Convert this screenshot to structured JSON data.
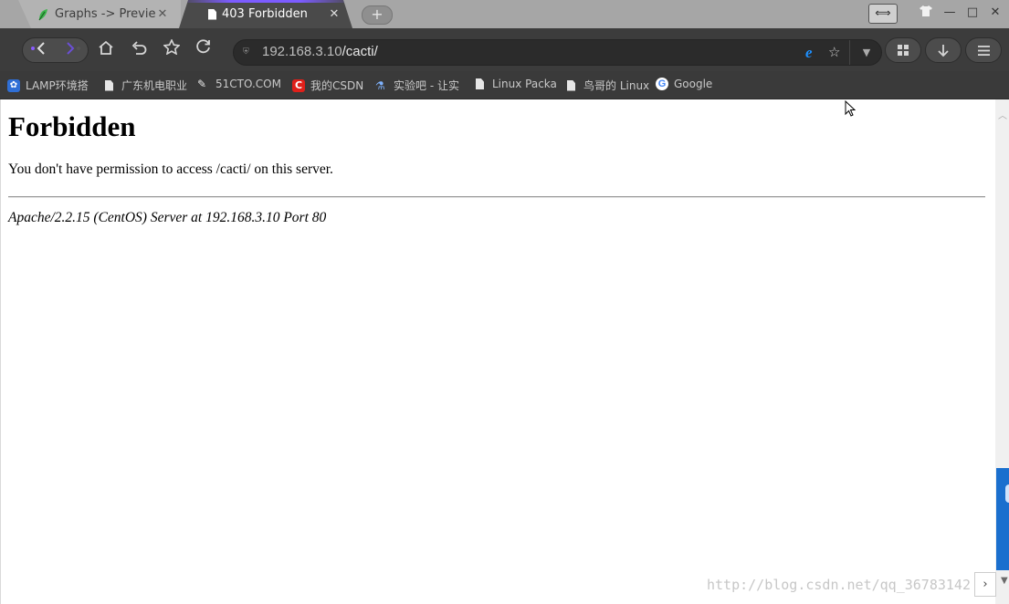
{
  "tabs": [
    {
      "title": "Graphs -> Preview",
      "close_glyph": "✕",
      "favicon": "cacti-leaf-icon",
      "active": false
    },
    {
      "title": "403 Forbidden",
      "close_glyph": "✕",
      "favicon": "page-icon",
      "active": true
    }
  ],
  "window": {
    "new_tab_glyph": "+",
    "minimize_glyph": "—",
    "maximize_glyph": "□",
    "close_glyph": "✕"
  },
  "nav": {
    "url_host": "192.168.3.10",
    "url_path": "/cacti/"
  },
  "bookmarks": [
    {
      "label": "LAMP环境搭",
      "icon": "lamp-site-icon"
    },
    {
      "label": "广东机电职业",
      "icon": "page-icon"
    },
    {
      "label": "51CTO.COM",
      "icon": "51cto-icon"
    },
    {
      "label": "我的CSDN",
      "icon": "csdn-icon"
    },
    {
      "label": "实验吧 - 让实",
      "icon": "shiyanba-icon"
    },
    {
      "label": "Linux Packa",
      "icon": "page-icon"
    },
    {
      "label": "鸟哥的 Linux",
      "icon": "page-icon"
    },
    {
      "label": "Google",
      "icon": "google-icon"
    }
  ],
  "page": {
    "heading": "Forbidden",
    "message": "You don't have permission to access /cacti/ on this server.",
    "address": "Apache/2.2.15 (CentOS) Server at 192.168.3.10 Port 80"
  },
  "watermark": "http://blog.csdn.net/qq_36783142",
  "colors": {
    "accent": "#7c5cff",
    "side_tab": "#1a6fce",
    "ie_blue": "#1e90ff"
  }
}
